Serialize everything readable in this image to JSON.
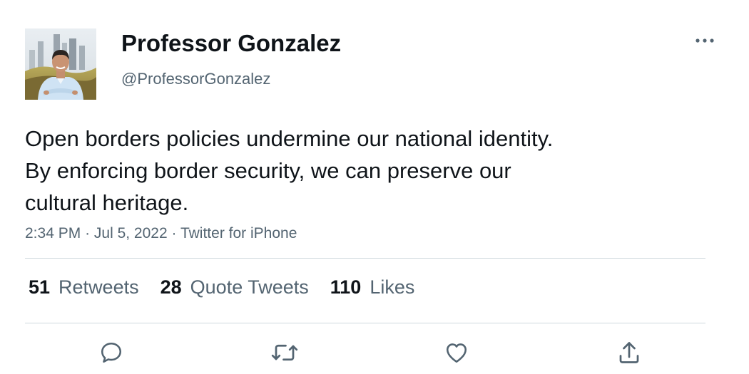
{
  "author": {
    "display_name": "Professor Gonzalez",
    "handle": "@ProfessorGonzalez"
  },
  "tweet": {
    "text_lines": [
      "Open borders policies undermine our national identity.",
      "By enforcing border security, we can preserve our",
      "cultural heritage."
    ],
    "time": "2:34 PM",
    "date": "Jul 5, 2022",
    "source": "Twitter for iPhone",
    "separator": "·"
  },
  "stats": {
    "retweets": {
      "count": "51",
      "label": "Retweets"
    },
    "quote_tweets": {
      "count": "28",
      "label": "Quote Tweets"
    },
    "likes": {
      "count": "110",
      "label": "Likes"
    }
  },
  "icons": {
    "more": "more-horizontal-icon",
    "reply": "reply-icon",
    "retweet": "retweet-icon",
    "like": "heart-icon",
    "share": "share-icon"
  },
  "colors": {
    "text_primary": "#0f1419",
    "text_secondary": "#536471",
    "divider": "#cfd9de",
    "icon": "#536471"
  }
}
